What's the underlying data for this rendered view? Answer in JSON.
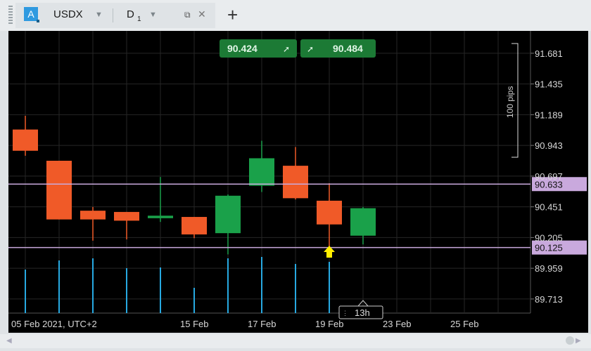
{
  "tab": {
    "badge": "A",
    "symbol": "USDX",
    "timeframe": "D",
    "timeframe_sub": "1"
  },
  "buttons": {
    "sell_price": "90.424",
    "buy_price": "90.484"
  },
  "pips_label": "100 pips",
  "time_marker": "13h",
  "colors": {
    "bull": "#1aa14a",
    "bear": "#f05a28",
    "volume": "#27a9e1",
    "level_line": "#c9a9dd",
    "arrow": "#ffee00"
  },
  "chart_data": {
    "type": "candlestick",
    "y_ticks": [
      "91.681",
      "91.435",
      "91.189",
      "90.943",
      "90.697",
      "90.451",
      "90.205",
      "89.959",
      "89.713"
    ],
    "x_labels": [
      "05 Feb 2021, UTC+2",
      "15 Feb",
      "17 Feb",
      "19 Feb",
      "23 Feb",
      "25 Feb"
    ],
    "ylim": [
      89.6,
      91.86
    ],
    "price_levels": [
      "90.633",
      "90.125"
    ],
    "candles": [
      {
        "o": 91.07,
        "h": 91.18,
        "l": 90.86,
        "c": 90.9
      },
      {
        "o": 90.82,
        "h": 90.82,
        "l": 90.35,
        "c": 90.35
      },
      {
        "o": 90.42,
        "h": 90.45,
        "l": 90.18,
        "c": 90.35
      },
      {
        "o": 90.41,
        "h": 90.41,
        "l": 90.19,
        "c": 90.34
      },
      {
        "o": 90.36,
        "h": 90.69,
        "l": 90.33,
        "c": 90.38
      },
      {
        "o": 90.37,
        "h": 90.37,
        "l": 90.2,
        "c": 90.23
      },
      {
        "o": 90.24,
        "h": 90.55,
        "l": 90.07,
        "c": 90.54
      },
      {
        "o": 90.62,
        "h": 90.98,
        "l": 90.57,
        "c": 90.84
      },
      {
        "o": 90.78,
        "h": 90.93,
        "l": 90.51,
        "c": 90.52
      },
      {
        "o": 90.5,
        "h": 90.64,
        "l": 90.13,
        "c": 90.31
      },
      {
        "o": 90.22,
        "h": 90.45,
        "l": 90.15,
        "c": 90.44
      }
    ],
    "volumes": [
      62,
      75,
      78,
      64,
      65,
      36,
      78,
      80,
      70,
      73,
      0
    ]
  }
}
